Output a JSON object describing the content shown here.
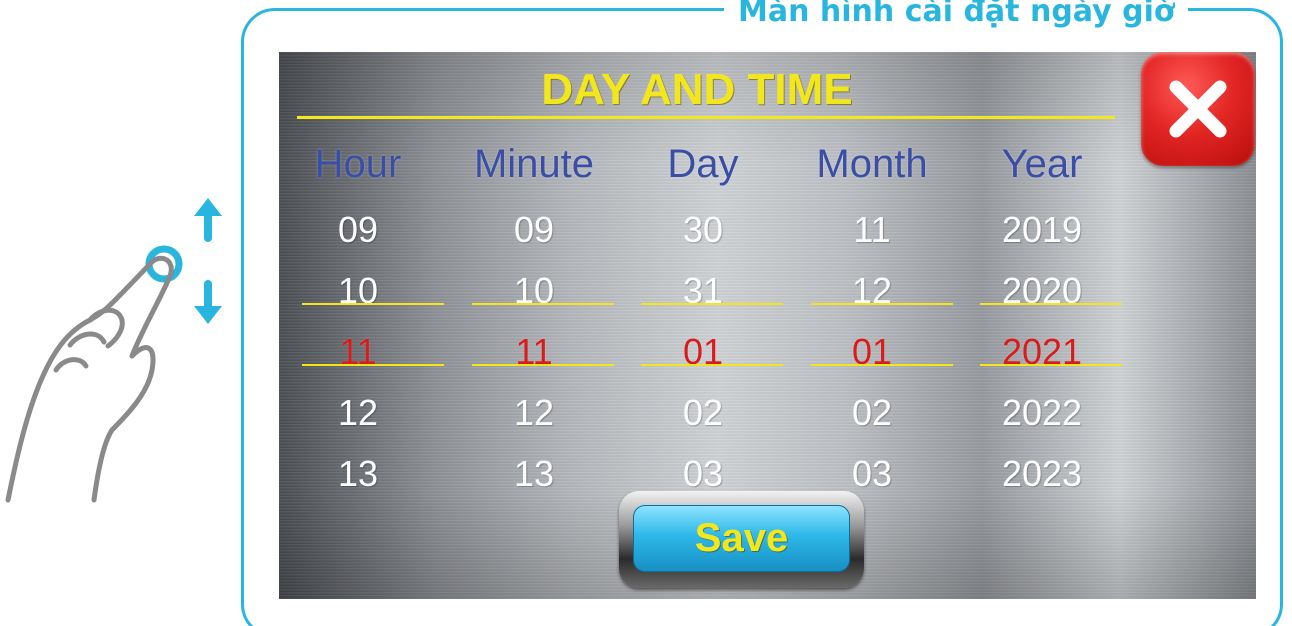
{
  "frame_title": "Màn hình cài đặt ngày giờ",
  "panel": {
    "title": "DAY AND TIME",
    "close_icon": "close-x-icon",
    "save_label": "Save"
  },
  "columns": [
    {
      "header": "Hour",
      "values": [
        "09",
        "10",
        "11",
        "12",
        "13"
      ],
      "selected": "11"
    },
    {
      "header": "Minute",
      "values": [
        "09",
        "10",
        "11",
        "12",
        "13"
      ],
      "selected": "11"
    },
    {
      "header": "Day",
      "values": [
        "30",
        "31",
        "01",
        "02",
        "03"
      ],
      "selected": "01"
    },
    {
      "header": "Month",
      "values": [
        "11",
        "12",
        "01",
        "02",
        "03"
      ],
      "selected": "01"
    },
    {
      "header": "Year",
      "values": [
        "2019",
        "2020",
        "2021",
        "2022",
        "2023"
      ],
      "selected": "2021"
    }
  ],
  "gesture": {
    "icons": [
      "swipe-hand-icon",
      "arrow-up-icon",
      "arrow-down-icon"
    ]
  },
  "colors": {
    "frame": "#29b6de",
    "title_yellow": "#f2e71c",
    "header_blue": "#3a4ea6",
    "selected_red": "#d81b1b",
    "close_red": "#e22624",
    "save_blue": "#2db8e9"
  }
}
